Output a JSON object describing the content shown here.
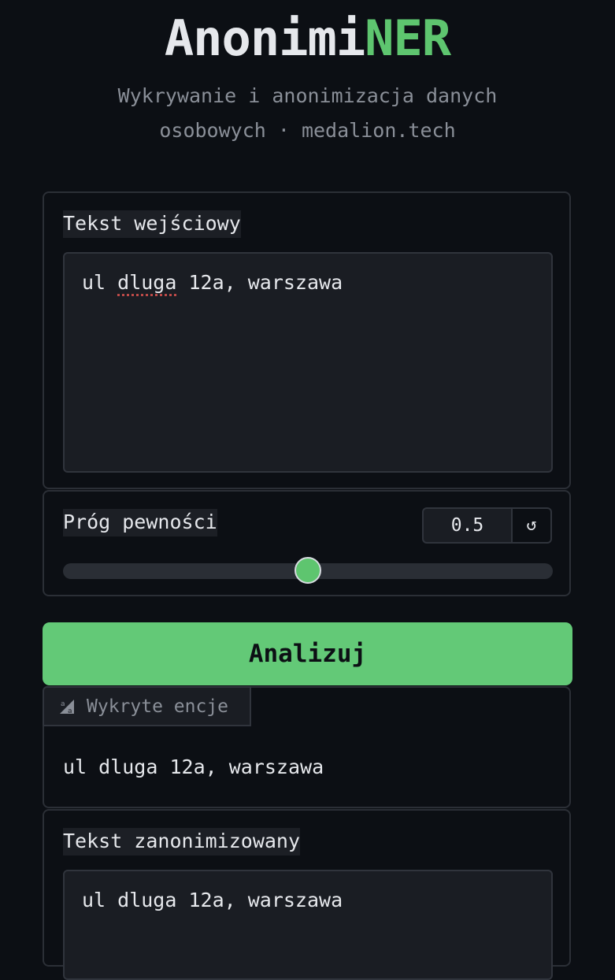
{
  "header": {
    "title_main": "Anonimi",
    "title_accent": "NER",
    "subtitle_line1": "Wykrywanie i anonimizacja danych",
    "subtitle_line2": "osobowych · medalion.tech"
  },
  "input_panel": {
    "label": "Tekst wejściowy",
    "text_before": "ul ",
    "text_misspelled": "dluga",
    "text_after": " 12a, warszawa"
  },
  "threshold": {
    "label": "Próg pewności",
    "value": "0.5",
    "level": 0.5,
    "reset_icon": "↺"
  },
  "analyze_button": {
    "label": "Analizuj"
  },
  "entities_panel": {
    "tab_label": "Wykryte encje",
    "tab_icon": "highlight-text-icon",
    "text": "ul dluga 12a, warszawa"
  },
  "anonymized_panel": {
    "label": "Tekst zanonimizowany",
    "text": "ul dluga 12a, warszawa"
  },
  "colors": {
    "accent": "#5ec56f",
    "button": "#63c977",
    "background": "#0c0f14"
  }
}
